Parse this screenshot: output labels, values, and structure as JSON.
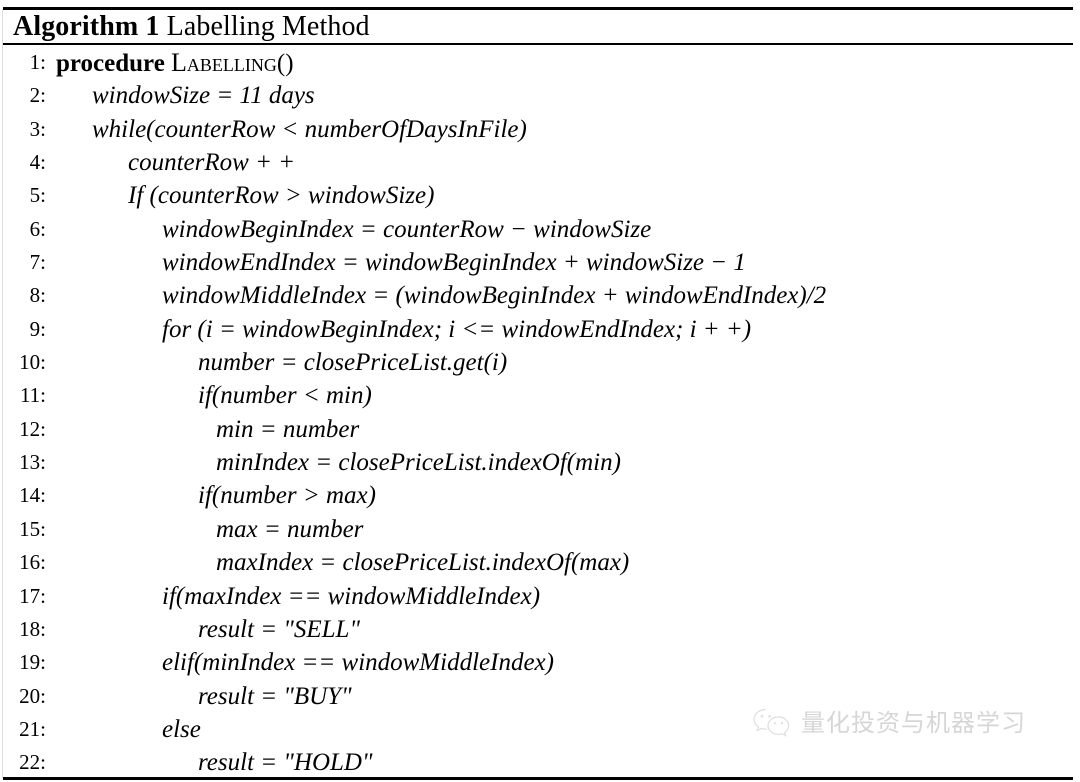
{
  "document": {
    "type": "algorithm-float",
    "title": {
      "keyword": "Algorithm 1",
      "name": "Labelling Method"
    }
  },
  "algorithm": {
    "lines": [
      {
        "no": "1:",
        "indent": 0,
        "text": "procedure Labelling()",
        "style": "keyword-smallcaps",
        "keyword": "procedure",
        "procname": "Labelling",
        "suffix": "()"
      },
      {
        "no": "2:",
        "indent": 1,
        "text": "windowSize = 11 days"
      },
      {
        "no": "3:",
        "indent": 1,
        "text": "while(counterRow < numberOfDaysInFile)"
      },
      {
        "no": "4:",
        "indent": 2,
        "text": "counterRow + +"
      },
      {
        "no": "5:",
        "indent": 2,
        "text": "If (counterRow > windowSize)"
      },
      {
        "no": "6:",
        "indent": 3,
        "text": "windowBeginIndex = counterRow − windowSize"
      },
      {
        "no": "7:",
        "indent": 3,
        "text": "windowEndIndex = windowBeginIndex + windowSize − 1"
      },
      {
        "no": "8:",
        "indent": 3,
        "text": "windowMiddleIndex = (windowBeginIndex + windowEndIndex)/2"
      },
      {
        "no": "9:",
        "indent": 3,
        "text": "for (i = windowBeginIndex; i <= windowEndIndex; i + +)"
      },
      {
        "no": "10:",
        "indent": 4,
        "text": "number = closePriceList.get(i)"
      },
      {
        "no": "11:",
        "indent": 4,
        "text": "if(number < min)"
      },
      {
        "no": "12:",
        "indent": 5,
        "text": "min = number"
      },
      {
        "no": "13:",
        "indent": 5,
        "text": "minIndex = closePriceList.indexOf(min)"
      },
      {
        "no": "14:",
        "indent": 4,
        "text": "if(number > max)"
      },
      {
        "no": "15:",
        "indent": 5,
        "text": "max = number"
      },
      {
        "no": "16:",
        "indent": 5,
        "text": "maxIndex = closePriceList.indexOf(max)"
      },
      {
        "no": "17:",
        "indent": 3,
        "text": "if(maxIndex == windowMiddleIndex)"
      },
      {
        "no": "18:",
        "indent": 4,
        "text": "result = \"SELL\""
      },
      {
        "no": "19:",
        "indent": 3,
        "text": "elif(minIndex == windowMiddleIndex)"
      },
      {
        "no": "20:",
        "indent": 4,
        "text": "result = \"BUY\""
      },
      {
        "no": "21:",
        "indent": 3,
        "text": "else"
      },
      {
        "no": "22:",
        "indent": 4,
        "text": "result = \"HOLD\""
      }
    ]
  },
  "watermark": {
    "icon": "wechat-logo-icon",
    "text": "量化投资与机器学习",
    "color": "#7a7a7a"
  }
}
